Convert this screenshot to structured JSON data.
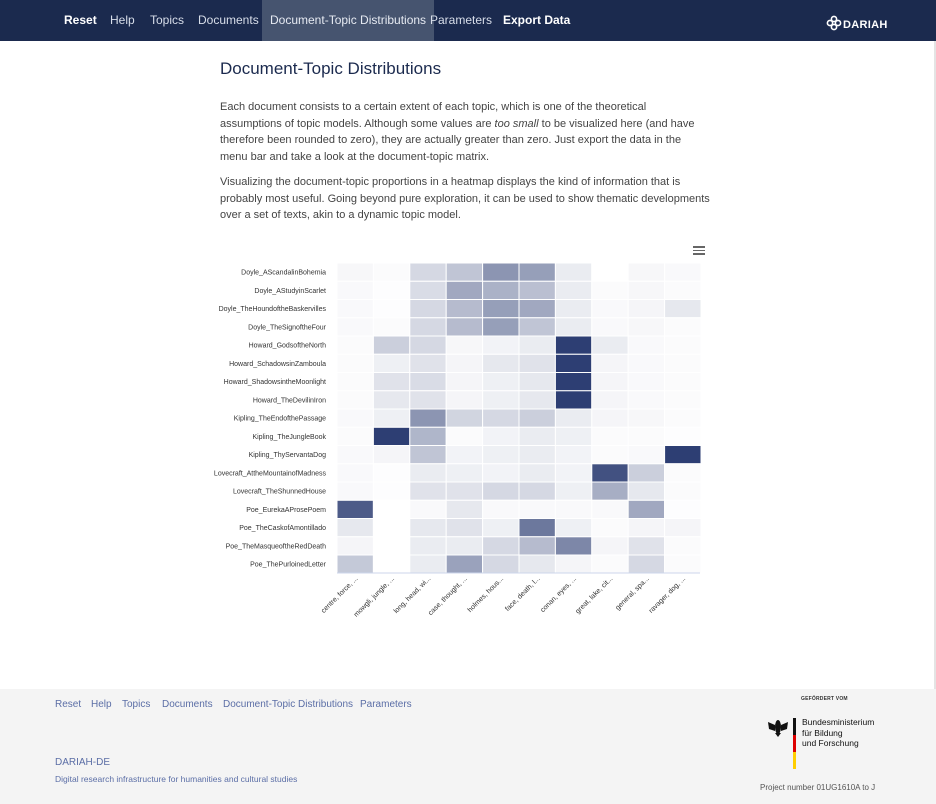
{
  "topnav": {
    "items": [
      "Reset",
      "Help",
      "Topics",
      "Documents",
      "Document-Topic Distributions",
      "Parameters",
      "Export Data"
    ],
    "brand": "DARIAH"
  },
  "content": {
    "title": "Document-Topic Distributions",
    "para1_a": "Each document consists to a certain extent of each topic, which is one of the theoretical assumptions of topic models. Although some values are ",
    "para1_em": "too small",
    "para1_b": " to be visualized here (and have therefore been rounded to zero), they are actually greater than zero. Just export the data in the menu bar and take a look at the document-topic matrix.",
    "para2": "Visualizing the document-topic proportions in a heatmap displays the kind of information that is probably most useful. Going beyond pure exploration, it can be used to show thematic developments over a set of texts, akin to a dynamic topic model."
  },
  "chart_data": {
    "type": "heatmap",
    "colors": {
      "low": "#ffffff",
      "high": "#2d3e73"
    },
    "y_categories": [
      "Doyle_AScandalinBohemia",
      "Doyle_AStudyinScarlet",
      "Doyle_TheHoundoftheBaskervilles",
      "Doyle_TheSignoftheFour",
      "Howard_GodsoftheNorth",
      "Howard_SchadowsinZamboula",
      "Howard_ShadowsintheMoonlight",
      "Howard_TheDevilinIron",
      "Kipling_TheEndofthePassage",
      "Kipling_TheJungleBook",
      "Kipling_ThyServantaDog",
      "Lovecraft_AttheMountainofMadness",
      "Lovecraft_TheShunnedHouse",
      "Poe_EurekaAProsePoem",
      "Poe_TheCaskofAmontillado",
      "Poe_TheMasqueoftheRedDeath",
      "Poe_ThePurloinedLetter"
    ],
    "x_categories": [
      "centre, force, ...",
      "mowgli, jungle, ...",
      "long, head, wi...",
      "case, thought, ...",
      "holmes, hous...",
      "face, death, l...",
      "conan, eyes, ...",
      "great, lake, cit...",
      "general, spa...",
      "ravager, dog, ..."
    ],
    "values": [
      [
        0.04,
        0.02,
        0.2,
        0.3,
        0.55,
        0.5,
        0.1,
        0.0,
        0.04,
        0.03
      ],
      [
        0.03,
        0.01,
        0.18,
        0.45,
        0.4,
        0.33,
        0.1,
        0.02,
        0.04,
        0.02
      ],
      [
        0.03,
        0.01,
        0.2,
        0.35,
        0.5,
        0.45,
        0.1,
        0.03,
        0.05,
        0.12
      ],
      [
        0.03,
        0.02,
        0.2,
        0.35,
        0.5,
        0.3,
        0.1,
        0.03,
        0.04,
        0.02
      ],
      [
        0.02,
        0.25,
        0.2,
        0.04,
        0.06,
        0.1,
        1.0,
        0.1,
        0.03,
        0.02
      ],
      [
        0.02,
        0.08,
        0.15,
        0.05,
        0.12,
        0.15,
        1.0,
        0.05,
        0.03,
        0.02
      ],
      [
        0.02,
        0.15,
        0.18,
        0.05,
        0.08,
        0.12,
        1.0,
        0.05,
        0.03,
        0.02
      ],
      [
        0.02,
        0.12,
        0.15,
        0.05,
        0.08,
        0.12,
        1.0,
        0.05,
        0.03,
        0.02
      ],
      [
        0.03,
        0.08,
        0.55,
        0.22,
        0.2,
        0.25,
        0.1,
        0.05,
        0.04,
        0.02
      ],
      [
        0.02,
        1.0,
        0.38,
        0.02,
        0.06,
        0.1,
        0.08,
        0.02,
        0.02,
        0.01
      ],
      [
        0.03,
        0.05,
        0.3,
        0.06,
        0.08,
        0.1,
        0.06,
        0.02,
        0.03,
        1.0
      ],
      [
        0.03,
        0.01,
        0.1,
        0.08,
        0.06,
        0.1,
        0.06,
        0.9,
        0.25,
        0.02
      ],
      [
        0.03,
        0.01,
        0.15,
        0.15,
        0.2,
        0.2,
        0.08,
        0.42,
        0.12,
        0.02
      ],
      [
        0.85,
        0.0,
        0.03,
        0.12,
        0.03,
        0.03,
        0.03,
        0.03,
        0.45,
        0.01
      ],
      [
        0.12,
        0.0,
        0.12,
        0.15,
        0.08,
        0.7,
        0.08,
        0.02,
        0.05,
        0.05
      ],
      [
        0.05,
        0.0,
        0.1,
        0.1,
        0.2,
        0.35,
        0.62,
        0.05,
        0.15,
        0.02
      ],
      [
        0.28,
        0.0,
        0.1,
        0.48,
        0.2,
        0.12,
        0.05,
        0.02,
        0.2,
        0.02
      ]
    ]
  },
  "footer": {
    "nav": [
      "Reset",
      "Help",
      "Topics",
      "Documents",
      "Document-Topic Distributions",
      "Parameters"
    ],
    "brand": "DARIAH-DE",
    "tagline": "Digital research infrastructure for humanities and cultural studies",
    "funded_by": "GEFÖRDERT VOM",
    "ministry": [
      "Bundesministerium",
      "für Bildung",
      "und Forschung"
    ],
    "project": "Project number 01UG1610A to J"
  }
}
